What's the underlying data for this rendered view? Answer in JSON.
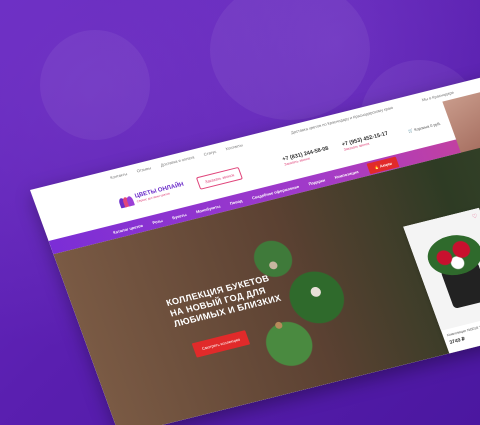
{
  "topbar": {
    "links": [
      "Контакты",
      "Отзывы",
      "Доставка и оплата",
      "Статус",
      "Контакты"
    ],
    "delivery_note": "Доставка цветов по Краснодару и Краснодарскому краю"
  },
  "header": {
    "logo_name": "ЦВЕТЫ ОНЛАЙН",
    "logo_tagline": "Сервис доставки цветов",
    "callback_label": "Заказать звонок",
    "phone1": "+7 (831) 244-58-08",
    "phone1_note": "Заказать звонок",
    "phone2": "+7 (953) 452-15-17",
    "phone2_note": "Заказать звонок",
    "city_note": "Мы в Краснодаре",
    "cart_label": "Корзина",
    "cart_total": "0 руб."
  },
  "nav": {
    "items": [
      "Каталог цветов",
      "Розы",
      "Букеты",
      "Монобукеты",
      "Повод",
      "Свадебное оформление",
      "Подарки",
      "Композиции"
    ],
    "action_label": "Акции"
  },
  "hero": {
    "title_lines": [
      "Коллекция букетов",
      "на новый год для",
      "любимых и близких"
    ],
    "button_label": "Смотреть коллекцию"
  },
  "product": {
    "name": "Композиция №5018 \"Яркое небо\"",
    "price": "3749 ₽"
  },
  "colors": {
    "brand_purple": "#6b2cc9",
    "accent_pink": "#e0457b",
    "action_red": "#e12a2a",
    "background": "#5a1fb0"
  }
}
